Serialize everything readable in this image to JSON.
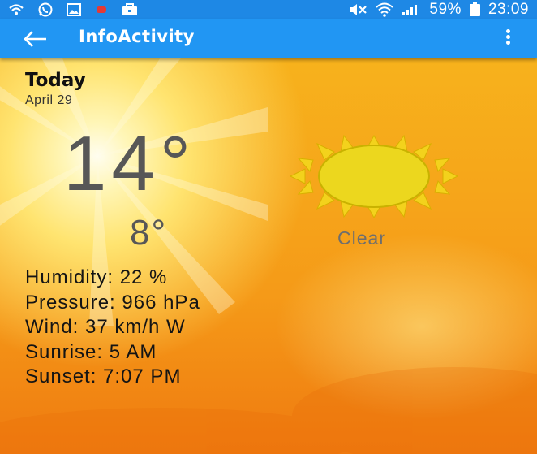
{
  "status_bar": {
    "battery_percent": "59%",
    "time": "23:09",
    "icons": [
      "wifi-calling-icon",
      "whatsapp-icon",
      "gallery-icon",
      "dot-icon",
      "briefcase-icon",
      "mute-icon",
      "wifi-icon",
      "signal-icon",
      "battery-icon"
    ]
  },
  "app_bar": {
    "title": "InfoActivity",
    "back_icon": "arrow-left-icon",
    "menu_icon": "more-vert-icon"
  },
  "weather": {
    "day": "Today",
    "date": "April 29",
    "high": "14°",
    "low": "8°",
    "condition": "Clear",
    "condition_icon": "sun-icon",
    "humidity": "Humidity: 22 %",
    "pressure": "Pressure: 966 hPa",
    "wind": "Wind: 37 km/h W",
    "sunrise": "Sunrise: 5 AM",
    "sunset": "Sunset: 7:07 PM"
  },
  "colors": {
    "status_bar": "#1E88E5",
    "app_bar": "#2196F3",
    "temperature_text": "#575757",
    "detail_text": "#141414",
    "background_orange": "#F6A51A"
  }
}
